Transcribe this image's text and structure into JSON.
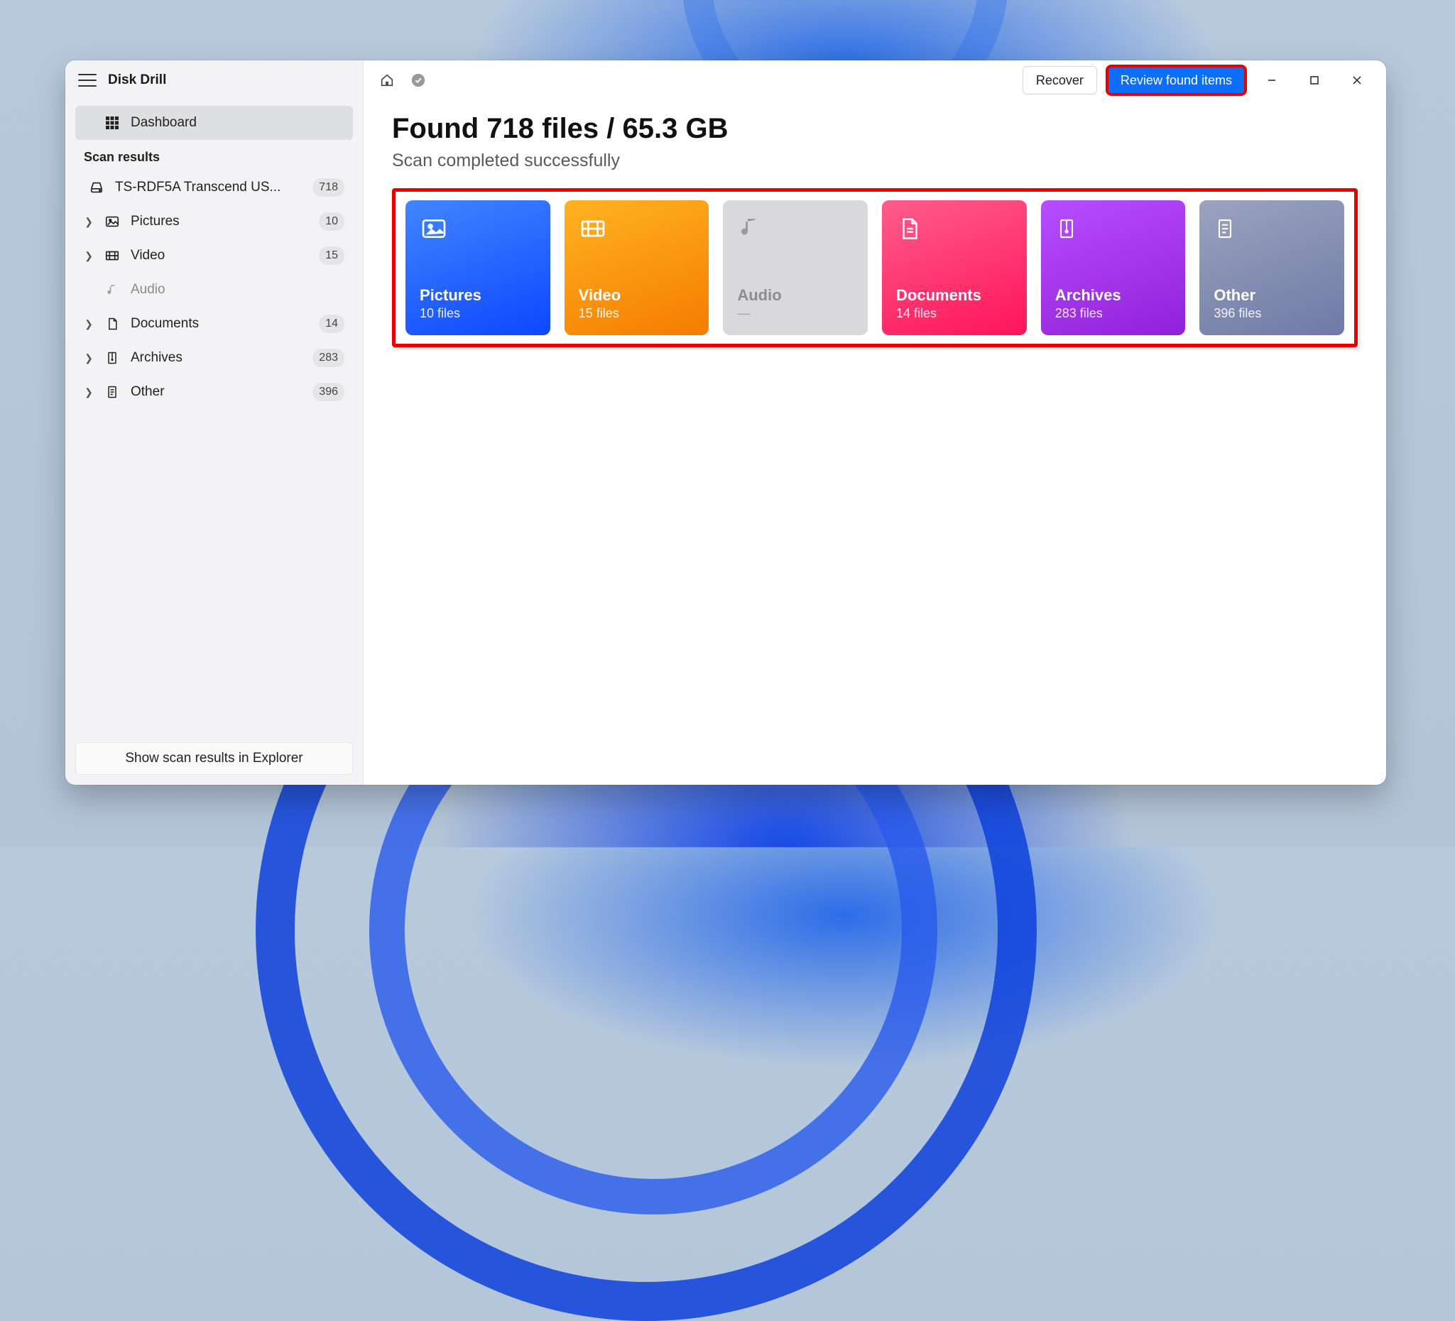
{
  "app": {
    "title": "Disk Drill"
  },
  "sidebar": {
    "dashboard_label": "Dashboard",
    "scan_results_label": "Scan results",
    "items": [
      {
        "label": "TS-RDF5A Transcend US...",
        "count": "718"
      },
      {
        "label": "Pictures",
        "count": "10"
      },
      {
        "label": "Video",
        "count": "15"
      },
      {
        "label": "Audio",
        "count": ""
      },
      {
        "label": "Documents",
        "count": "14"
      },
      {
        "label": "Archives",
        "count": "283"
      },
      {
        "label": "Other",
        "count": "396"
      }
    ],
    "footer": "Show scan results in Explorer"
  },
  "topbar": {
    "recover_label": "Recover",
    "review_label": "Review found items"
  },
  "main": {
    "title": "Found 718 files / 65.3 GB",
    "subtitle": "Scan completed successfully"
  },
  "cards": {
    "pictures": {
      "title": "Pictures",
      "subtitle": "10 files"
    },
    "video": {
      "title": "Video",
      "subtitle": "15 files"
    },
    "audio": {
      "title": "Audio",
      "subtitle": "—"
    },
    "documents": {
      "title": "Documents",
      "subtitle": "14 files"
    },
    "archives": {
      "title": "Archives",
      "subtitle": "283 files"
    },
    "other": {
      "title": "Other",
      "subtitle": "396 files"
    }
  }
}
